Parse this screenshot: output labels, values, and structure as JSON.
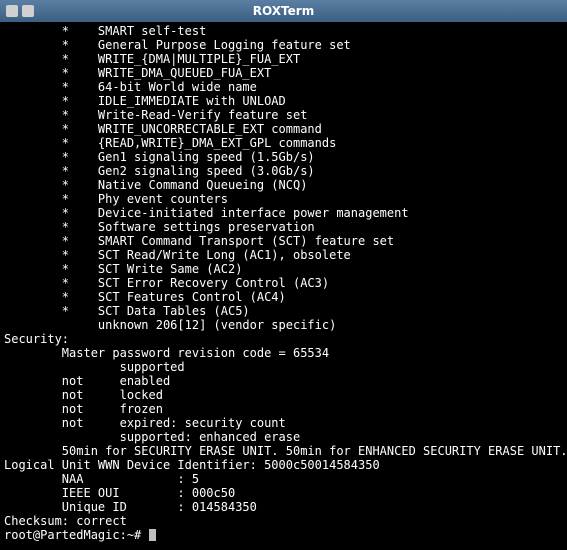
{
  "window": {
    "title": "ROXTerm"
  },
  "lines": [
    "        *    SMART self-test",
    "        *    General Purpose Logging feature set",
    "        *    WRITE_{DMA|MULTIPLE}_FUA_EXT",
    "        *    WRITE_DMA_QUEUED_FUA_EXT",
    "        *    64-bit World wide name",
    "        *    IDLE_IMMEDIATE with UNLOAD",
    "        *    Write-Read-Verify feature set",
    "        *    WRITE_UNCORRECTABLE_EXT command",
    "        *    {READ,WRITE}_DMA_EXT_GPL commands",
    "        *    Gen1 signaling speed (1.5Gb/s)",
    "        *    Gen2 signaling speed (3.0Gb/s)",
    "        *    Native Command Queueing (NCQ)",
    "        *    Phy event counters",
    "        *    Device-initiated interface power management",
    "        *    Software settings preservation",
    "        *    SMART Command Transport (SCT) feature set",
    "        *    SCT Read/Write Long (AC1), obsolete",
    "        *    SCT Write Same (AC2)",
    "        *    SCT Error Recovery Control (AC3)",
    "        *    SCT Features Control (AC4)",
    "        *    SCT Data Tables (AC5)",
    "             unknown 206[12] (vendor specific)",
    "Security: ",
    "        Master password revision code = 65534",
    "                supported",
    "        not     enabled",
    "        not     locked",
    "        not     frozen",
    "        not     expired: security count",
    "                supported: enhanced erase",
    "        50min for SECURITY ERASE UNIT. 50min for ENHANCED SECURITY ERASE UNIT.",
    "Logical Unit WWN Device Identifier: 5000c50014584350",
    "        NAA             : 5",
    "        IEEE OUI        : 000c50",
    "        Unique ID       : 014584350",
    "Checksum: correct"
  ],
  "prompt": "root@PartedMagic:~# "
}
